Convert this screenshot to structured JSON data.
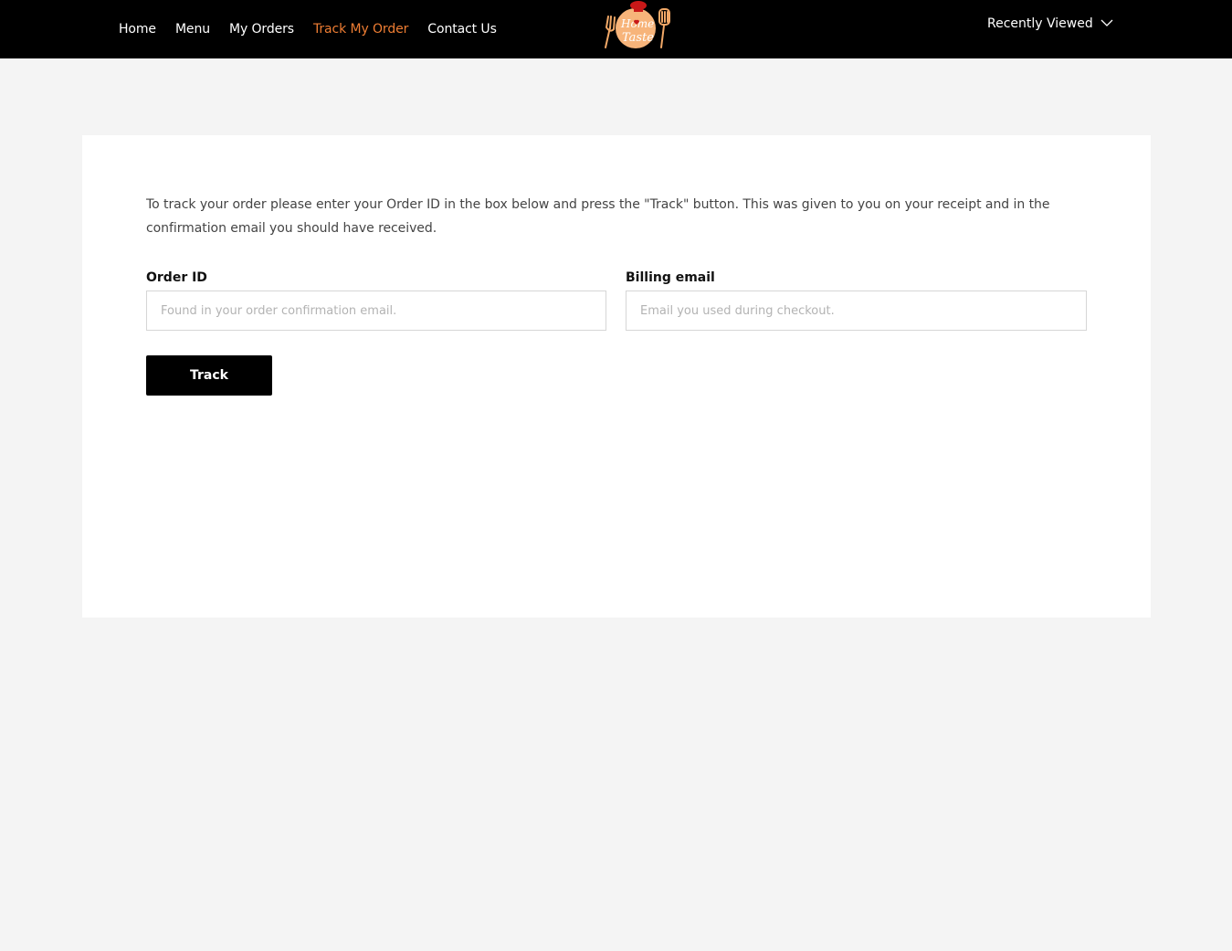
{
  "header": {
    "nav": [
      {
        "label": "Home",
        "active": false
      },
      {
        "label": "Menu",
        "active": false
      },
      {
        "label": "My Orders",
        "active": false
      },
      {
        "label": "Track My Order",
        "active": true
      },
      {
        "label": "Contact Us",
        "active": false
      }
    ],
    "logo_icon": "home-taste-logo",
    "logo_text": "Home Taste",
    "recently_viewed": "Recently Viewed",
    "chevron_icon": "chevron-down-icon",
    "accent_color": "#ee7d33"
  },
  "tracking": {
    "intro": "To track your order please enter your Order ID in the box below and press the \"Track\" button. This was given to you on your receipt and in the confirmation email you should have received.",
    "order_id_label": "Order ID",
    "order_id_placeholder": "Found in your order confirmation email.",
    "order_id_value": "",
    "billing_email_label": "Billing email",
    "billing_email_placeholder": "Email you used during checkout.",
    "billing_email_value": "",
    "track_button": "Track"
  }
}
